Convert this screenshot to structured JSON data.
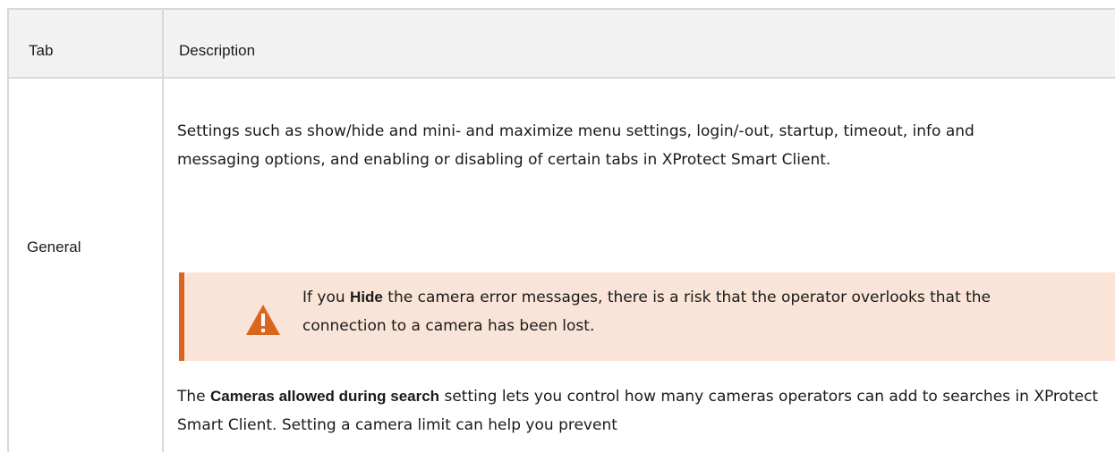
{
  "table": {
    "headers": {
      "tab": "Tab",
      "description": "Description"
    },
    "rows": [
      {
        "tab": "General",
        "description": {
          "intro": "Settings such as show/hide and mini- and maximize menu settings, login/-out, startup, timeout, info and messaging options, and enabling or disabling of certain tabs in XProtect Smart Client.",
          "warning": {
            "icon": "warning-icon",
            "prefix": "If you ",
            "bold": "Hide",
            "suffix": " the camera error messages, there is a risk that the operator overlooks that the connection to a camera has been lost."
          },
          "cameras": {
            "prefix": "The ",
            "bold": "Cameras allowed during search",
            "suffix": " setting lets you control how many cameras operators can add to searches in XProtect Smart Client. Setting a camera limit can help you prevent"
          }
        }
      }
    ]
  },
  "colors": {
    "header_bg": "#f2f2f2",
    "border": "#d9d9d9",
    "warning_bg": "#fae4d7",
    "warning_accent": "#d8661f",
    "text": "#1a1a1a"
  }
}
